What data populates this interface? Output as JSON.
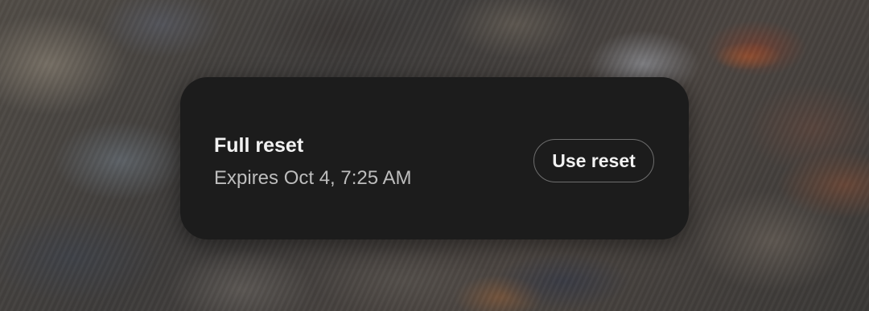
{
  "reset_card": {
    "title": "Full reset",
    "expiry": "Expires Oct 4, 7:25 AM",
    "action_label": "Use reset"
  },
  "colors": {
    "card_background": "#1c1c1c",
    "title_text": "#f2f2f2",
    "subtitle_text": "#bdbdbd",
    "button_border": "#6d6d6d"
  }
}
